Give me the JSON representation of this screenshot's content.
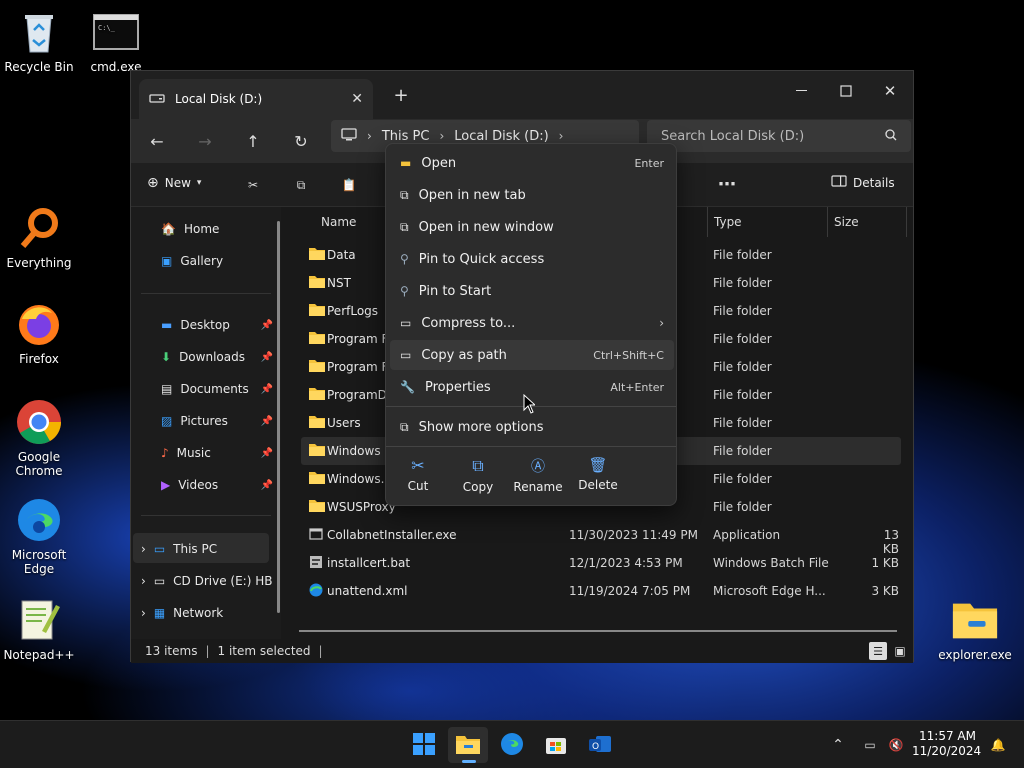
{
  "desktop": {
    "icons": [
      {
        "label": "Recycle Bin",
        "name": "recycle-bin-icon"
      },
      {
        "label": "cmd.exe",
        "name": "cmd-icon"
      },
      {
        "label": "Everything",
        "name": "everything-icon"
      },
      {
        "label": "Firefox",
        "name": "firefox-icon"
      },
      {
        "label": "Google Chrome",
        "name": "chrome-icon"
      },
      {
        "label": "Microsoft Edge",
        "name": "edge-icon"
      },
      {
        "label": "Notepad++",
        "name": "notepadpp-icon"
      },
      {
        "label": "explorer.exe",
        "name": "explorer-icon"
      }
    ]
  },
  "window": {
    "tab_title": "Local Disk (D:)",
    "address": {
      "this_pc": "This PC",
      "local_disk": "Local Disk (D:)"
    },
    "search_placeholder": "Search Local Disk (D:)",
    "toolbar": {
      "new": "New",
      "details": "Details"
    },
    "sidebar": {
      "home": "Home",
      "gallery": "Gallery",
      "desktop": "Desktop",
      "downloads": "Downloads",
      "documents": "Documents",
      "pictures": "Pictures",
      "music": "Music",
      "videos": "Videos",
      "this_pc": "This PC",
      "cd_drive": "CD Drive (E:) HB",
      "network": "Network"
    },
    "columns": {
      "name": "Name",
      "type": "Type",
      "size": "Size"
    },
    "files": [
      {
        "name": "Data",
        "date": "",
        "type": "File folder",
        "size": ""
      },
      {
        "name": "NST",
        "date": "",
        "type": "File folder",
        "size": ""
      },
      {
        "name": "PerfLogs",
        "date": "",
        "type": "File folder",
        "size": ""
      },
      {
        "name": "Program F",
        "date": "",
        "type": "File folder",
        "size": ""
      },
      {
        "name": "Program F",
        "date": "",
        "type": "File folder",
        "size": ""
      },
      {
        "name": "ProgramDa",
        "date": "",
        "type": "File folder",
        "size": ""
      },
      {
        "name": "Users",
        "date": "",
        "type": "File folder",
        "size": ""
      },
      {
        "name": "Windows",
        "date": "",
        "type": "File folder",
        "size": ""
      },
      {
        "name": "Windows.c",
        "date": "",
        "type": "File folder",
        "size": ""
      },
      {
        "name": "WSUSProxy",
        "date": "",
        "type": "File folder",
        "size": ""
      },
      {
        "name": "CollabnetInstaller.exe",
        "date": "11/30/2023 11:49 PM",
        "type": "Application",
        "size": "13 KB"
      },
      {
        "name": "installcert.bat",
        "date": "12/1/2023 4:53 PM",
        "type": "Windows Batch File",
        "size": "1 KB"
      },
      {
        "name": "unattend.xml",
        "date": "11/19/2024 7:05 PM",
        "type": "Microsoft Edge H...",
        "size": "3 KB"
      }
    ],
    "status": {
      "items": "13 items",
      "selected": "1 item selected"
    }
  },
  "context_menu": {
    "items": [
      {
        "label": "Open",
        "shortcut": "Enter"
      },
      {
        "label": "Open in new tab",
        "shortcut": ""
      },
      {
        "label": "Open in new window",
        "shortcut": ""
      },
      {
        "label": "Pin to Quick access",
        "shortcut": ""
      },
      {
        "label": "Pin to Start",
        "shortcut": ""
      },
      {
        "label": "Compress to...",
        "shortcut": ""
      },
      {
        "label": "Copy as path",
        "shortcut": "Ctrl+Shift+C"
      },
      {
        "label": "Properties",
        "shortcut": "Alt+Enter"
      },
      {
        "label": "Show more options",
        "shortcut": ""
      }
    ],
    "quick_actions": {
      "cut": "Cut",
      "copy": "Copy",
      "rename": "Rename",
      "delete": "Delete"
    }
  },
  "taskbar": {
    "time": "11:57 AM",
    "date": "11/20/2024"
  }
}
